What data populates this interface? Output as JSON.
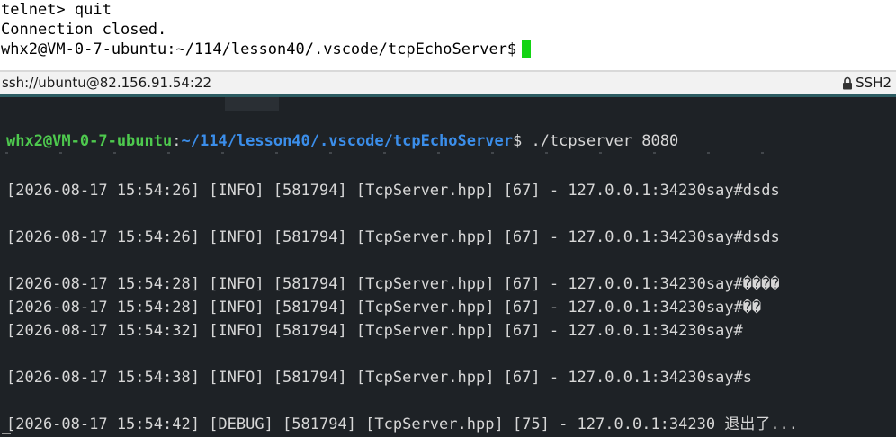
{
  "top_terminal": {
    "lines": [
      "telnet> quit",
      "Connection closed.",
      "whx2@VM-0-7-ubuntu:~/114/lesson40/.vscode/tcpEchoServer$"
    ]
  },
  "status_bar": {
    "address": "ssh://ubuntu@82.156.91.54:22",
    "protocol": "SSH2",
    "icon": "lock-icon"
  },
  "bottom_terminal": {
    "prompt": {
      "user_host": "whx2@VM-0-7-ubuntu",
      "separator": ":",
      "path": "~/114/lesson40/.vscode/tcpEchoServer",
      "dollar": "$",
      "command": " ./tcpserver 8080"
    },
    "log_lines": [
      "[2026-08-17 15:54:26] [INFO] [581794] [TcpServer.hpp] [67] - 127.0.0.1:34230say#dsds",
      "[2026-08-17 15:54:26] [INFO] [581794] [TcpServer.hpp] [67] - 127.0.0.1:34230say#dsds",
      "[2026-08-17 15:54:28] [INFO] [581794] [TcpServer.hpp] [67] - 127.0.0.1:34230say#����",
      "[2026-08-17 15:54:28] [INFO] [581794] [TcpServer.hpp] [67] - 127.0.0.1:34230say#��",
      "[2026-08-17 15:54:32] [INFO] [581794] [TcpServer.hpp] [67] - 127.0.0.1:34230say#",
      "[2026-08-17 15:54:38] [INFO] [581794] [TcpServer.hpp] [67] - 127.0.0.1:34230say#s",
      "[2026-08-17 15:54:42] [DEBUG] [581794] [TcpServer.hpp] [75] - 127.0.0.1:34230 退出了..."
    ]
  },
  "colors": {
    "cursor": "#13d413",
    "prompt_user": "#4ec94e",
    "prompt_path": "#3b8eea",
    "terminal_bg": "#1e2226",
    "terminal_text": "#d7d7d7"
  }
}
